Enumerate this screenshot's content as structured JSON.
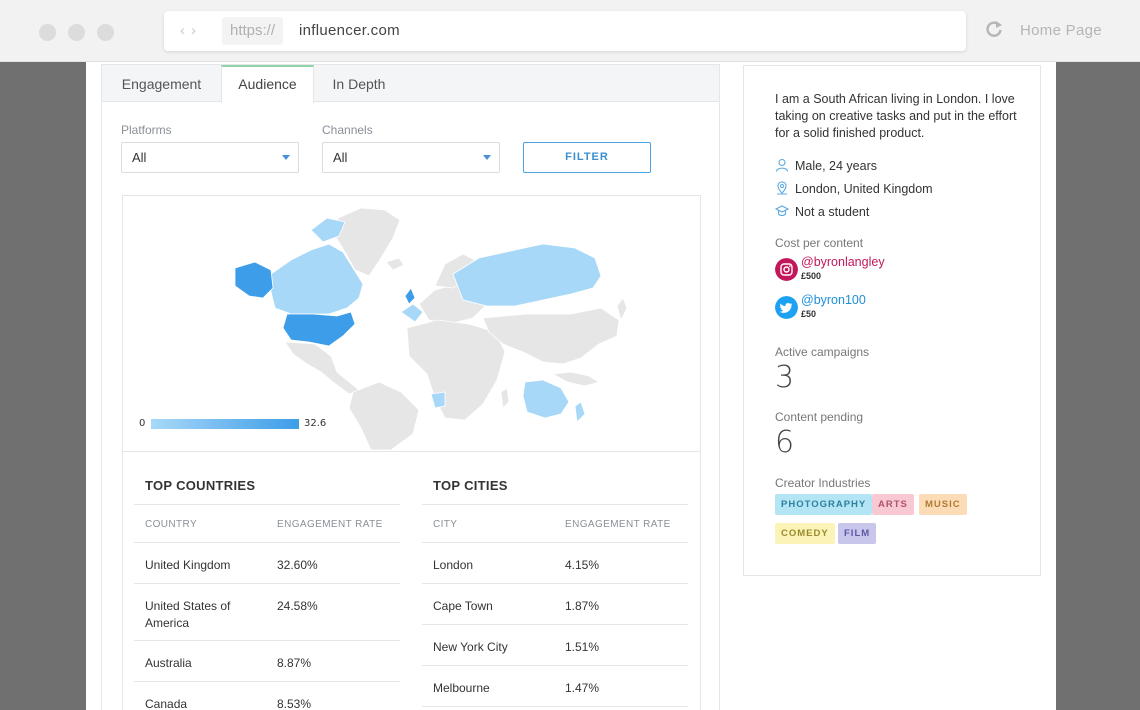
{
  "browser": {
    "protocol": "https://",
    "host": "influencer.com",
    "home_link": "Home Page"
  },
  "tabs": [
    {
      "label": "Engagement",
      "active": false
    },
    {
      "label": "Audience",
      "active": true
    },
    {
      "label": "In Depth",
      "active": false
    }
  ],
  "filters": {
    "platforms_label": "Platforms",
    "platforms_value": "All",
    "channels_label": "Channels",
    "channels_value": "All",
    "filter_button": "FILTER"
  },
  "map": {
    "legend_min": "0",
    "legend_max": "32.6",
    "highlighted": [
      {
        "country": "United Kingdom",
        "value": 32.6
      },
      {
        "country": "United States of America",
        "value": 24.58
      },
      {
        "country": "Australia",
        "value": 8.87
      },
      {
        "country": "Canada",
        "value": 8.53
      }
    ],
    "colors": {
      "low": "#a8d8f8",
      "high": "#3d9de8",
      "none": "#e6e6e6"
    }
  },
  "top_countries": {
    "title": "TOP COUNTRIES",
    "col1": "COUNTRY",
    "col2": "ENGAGEMENT RATE",
    "rows": [
      {
        "name": "United Kingdom",
        "rate": "32.60%"
      },
      {
        "name": "United States of America",
        "rate": "24.58%"
      },
      {
        "name": "Australia",
        "rate": "8.87%"
      },
      {
        "name": "Canada",
        "rate": "8.53%"
      }
    ]
  },
  "top_cities": {
    "title": "TOP CITIES",
    "col1": "CITY",
    "col2": "ENGAGEMENT RATE",
    "rows": [
      {
        "name": "London",
        "rate": "4.15%"
      },
      {
        "name": "Cape Town",
        "rate": "1.87%"
      },
      {
        "name": "New York City",
        "rate": "1.51%"
      },
      {
        "name": "Melbourne",
        "rate": "1.47%"
      }
    ]
  },
  "profile": {
    "bio": "I am a South African living in London. I love taking on creative tasks and put in the effort for a solid finished product.",
    "gender_age": "Male, 24 years",
    "location": "London, United Kingdom",
    "student": "Not a student",
    "cost_label": "Cost per content",
    "socials": [
      {
        "platform": "instagram",
        "handle": "@byronlangley",
        "price": "£500",
        "color": "#c2185b",
        "icon": "instagram-icon"
      },
      {
        "platform": "twitter",
        "handle": "@byron100",
        "price": "£50",
        "color": "#1da1f2",
        "icon": "twitter-icon"
      }
    ],
    "active_label": "Active campaigns",
    "active_value": "3",
    "pending_label": "Content pending",
    "pending_value": "6",
    "industries_label": "Creator Industries",
    "industries": [
      {
        "label": "PHOTOGRAPHY",
        "bg": "#b3e5f5",
        "fg": "#2f7f9e"
      },
      {
        "label": "ARTS",
        "bg": "#f9c9d3",
        "fg": "#b0546a"
      },
      {
        "label": "MUSIC",
        "bg": "#fbdcb6",
        "fg": "#b07a33"
      },
      {
        "label": "COMEDY",
        "bg": "#fbf3b8",
        "fg": "#9a8a2c"
      },
      {
        "label": "FILM",
        "bg": "#c9c6ec",
        "fg": "#5e58a3"
      }
    ]
  }
}
